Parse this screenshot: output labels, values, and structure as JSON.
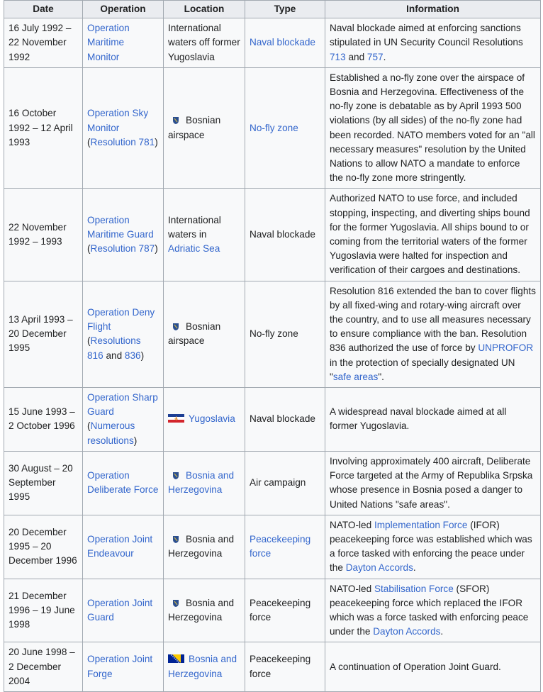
{
  "colors": {
    "link": "#3366cc",
    "header_bg": "#eaecf0",
    "cell_bg": "#f8f9fa",
    "border": "#a2a9b1"
  },
  "headers": [
    "Date",
    "Operation",
    "Location",
    "Type",
    "Information"
  ],
  "rows": [
    {
      "date": [
        {
          "t": "16 July 1992 – 22 November 1992"
        }
      ],
      "operation": [
        {
          "t": "Operation Maritime Monitor",
          "link": true
        }
      ],
      "location": {
        "flag": null,
        "parts": [
          {
            "t": "International waters off former Yugoslavia"
          }
        ]
      },
      "type": [
        {
          "t": "Naval blockade",
          "link": true
        }
      ],
      "info": [
        {
          "t": "Naval blockade aimed at enforcing sanctions stipulated in UN Security Council Resolutions "
        },
        {
          "t": "713",
          "link": true
        },
        {
          "t": " and "
        },
        {
          "t": "757",
          "link": true
        },
        {
          "t": "."
        }
      ]
    },
    {
      "date": [
        {
          "t": "16 October 1992 – 12 April 1993"
        }
      ],
      "operation": [
        {
          "t": "Operation Sky Monitor",
          "link": true
        },
        {
          "t": " ("
        },
        {
          "t": "Resolution 781",
          "link": true
        },
        {
          "t": ")"
        }
      ],
      "location": {
        "flag": "bosnia-coat-of-arms-icon",
        "parts": [
          {
            "t": "Bosnian airspace"
          }
        ]
      },
      "type": [
        {
          "t": "No-fly zone",
          "link": true
        }
      ],
      "info": [
        {
          "t": "Established a no-fly zone over the airspace of Bosnia and Herzegovina. Effectiveness of the no-fly zone is debatable as by April 1993 500 violations (by all sides) of the no-fly zone had been recorded. NATO members voted for an \"all necessary measures\" resolution by the United Nations to allow NATO a mandate to enforce the no-fly zone more stringently."
        }
      ]
    },
    {
      "date": [
        {
          "t": "22 November 1992 – 1993"
        }
      ],
      "operation": [
        {
          "t": "Operation Maritime Guard",
          "link": true
        },
        {
          "t": " ("
        },
        {
          "t": "Resolution 787",
          "link": true
        },
        {
          "t": ")"
        }
      ],
      "location": {
        "flag": null,
        "parts": [
          {
            "t": "International waters in "
          },
          {
            "t": "Adriatic Sea",
            "link": true
          }
        ]
      },
      "type": [
        {
          "t": "Naval blockade"
        }
      ],
      "info": [
        {
          "t": "Authorized NATO to use force, and included stopping, inspecting, and diverting ships bound for the former Yugoslavia. All ships bound to or coming from the territorial waters of the former Yugoslavia were halted for inspection and verification of their cargoes and destinations."
        }
      ]
    },
    {
      "date": [
        {
          "t": "13 April 1993 – 20 December 1995"
        }
      ],
      "operation": [
        {
          "t": "Operation Deny Flight",
          "link": true
        },
        {
          "t": " ("
        },
        {
          "t": "Resolutions 816",
          "link": true
        },
        {
          "t": " and "
        },
        {
          "t": "836",
          "link": true
        },
        {
          "t": ")"
        }
      ],
      "location": {
        "flag": "bosnia-coat-of-arms-icon",
        "parts": [
          {
            "t": "Bosnian airspace"
          }
        ]
      },
      "type": [
        {
          "t": "No-fly zone"
        }
      ],
      "info": [
        {
          "t": "Resolution 816 extended the ban to cover flights by all fixed-wing and rotary-wing aircraft over the country, and to use all measures necessary to ensure compliance with the ban. Resolution 836 authorized the use of force by "
        },
        {
          "t": "UNPROFOR",
          "link": true
        },
        {
          "t": " in the protection of specially designated UN \""
        },
        {
          "t": "safe areas",
          "link": true
        },
        {
          "t": "\"."
        }
      ]
    },
    {
      "date": [
        {
          "t": "15 June 1993 – 2 October 1996"
        }
      ],
      "operation": [
        {
          "t": "Operation Sharp Guard",
          "link": true
        },
        {
          "t": " ("
        },
        {
          "t": "Numerous resolutions",
          "link": true
        },
        {
          "t": ")"
        }
      ],
      "location": {
        "flag": "yugoslavia-flag-icon",
        "parts": [
          {
            "t": "Yugoslavia",
            "link": true
          }
        ]
      },
      "type": [
        {
          "t": "Naval blockade"
        }
      ],
      "info": [
        {
          "t": "A widespread naval blockade aimed at all former Yugoslavia."
        }
      ]
    },
    {
      "date": [
        {
          "t": "30 August – 20 September 1995"
        }
      ],
      "operation": [
        {
          "t": "Operation Deliberate Force",
          "link": true
        }
      ],
      "location": {
        "flag": "bosnia-coat-of-arms-icon",
        "parts": [
          {
            "t": "Bosnia and Herzegovina",
            "link": true
          }
        ]
      },
      "type": [
        {
          "t": "Air campaign"
        }
      ],
      "info": [
        {
          "t": "Involving approximately 400 aircraft, Deliberate Force targeted at the Army of Republika Srpska whose presence in Bosnia posed a danger to United Nations \"safe areas\"."
        }
      ]
    },
    {
      "date": [
        {
          "t": "20 December 1995 – 20 December 1996"
        }
      ],
      "operation": [
        {
          "t": "Operation Joint Endeavour",
          "link": true
        }
      ],
      "location": {
        "flag": "bosnia-coat-of-arms-icon",
        "parts": [
          {
            "t": "Bosnia and Herzegovina"
          }
        ]
      },
      "type": [
        {
          "t": "Peacekeeping force",
          "link": true
        }
      ],
      "info": [
        {
          "t": "NATO-led "
        },
        {
          "t": "Implementation Force",
          "link": true
        },
        {
          "t": " (IFOR) peacekeeping force was established which was a force tasked with enforcing the peace under the "
        },
        {
          "t": "Dayton Accords",
          "link": true
        },
        {
          "t": "."
        }
      ]
    },
    {
      "date": [
        {
          "t": "21 December 1996 – 19 June 1998"
        }
      ],
      "operation": [
        {
          "t": "Operation Joint Guard",
          "link": true
        }
      ],
      "location": {
        "flag": "bosnia-coat-of-arms-icon",
        "parts": [
          {
            "t": "Bosnia and Herzegovina"
          }
        ]
      },
      "type": [
        {
          "t": "Peacekeeping force"
        }
      ],
      "info": [
        {
          "t": "NATO-led "
        },
        {
          "t": "Stabilisation Force",
          "link": true
        },
        {
          "t": " (SFOR) peacekeeping force which replaced the IFOR which was a force tasked with enforcing peace under the "
        },
        {
          "t": "Dayton Accords",
          "link": true
        },
        {
          "t": "."
        }
      ]
    },
    {
      "date": [
        {
          "t": "20 June 1998 – 2 December 2004"
        }
      ],
      "operation": [
        {
          "t": "Operation Joint Forge",
          "link": true
        }
      ],
      "location": {
        "flag": "bosnia-herzegovina-flag-icon",
        "parts": [
          {
            "t": "Bosnia and Herzegovina",
            "link": true
          }
        ]
      },
      "type": [
        {
          "t": "Peacekeeping force"
        }
      ],
      "info": [
        {
          "t": "A continuation of Operation Joint Guard."
        }
      ]
    }
  ]
}
